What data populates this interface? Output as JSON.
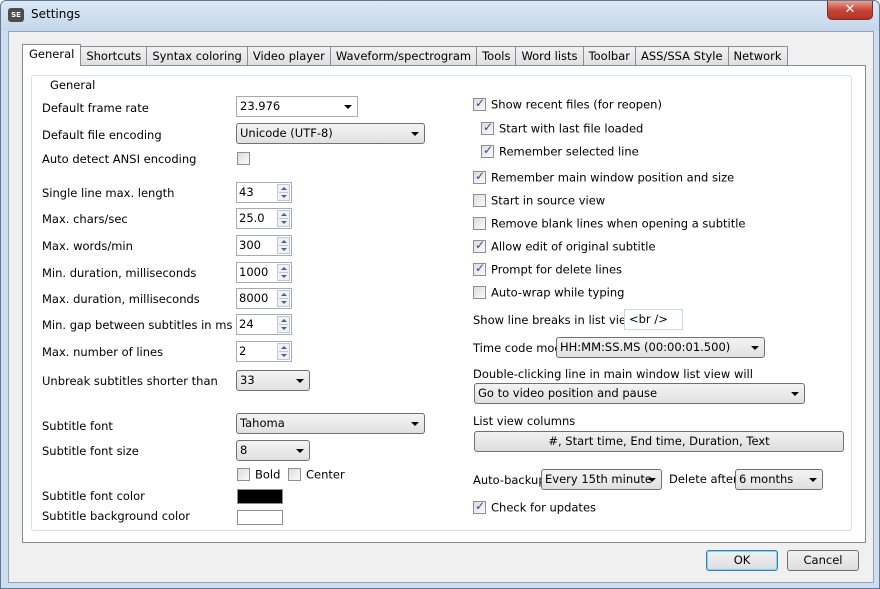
{
  "window": {
    "title": "Settings",
    "app_icon_text": "SE",
    "close_glyph": "✕"
  },
  "tabs": [
    {
      "label": "General",
      "active": true
    },
    {
      "label": "Shortcuts"
    },
    {
      "label": "Syntax coloring"
    },
    {
      "label": "Video player"
    },
    {
      "label": "Waveform/spectrogram"
    },
    {
      "label": "Tools"
    },
    {
      "label": "Word lists"
    },
    {
      "label": "Toolbar"
    },
    {
      "label": "ASS/SSA Style"
    },
    {
      "label": "Network"
    }
  ],
  "group": {
    "title": "General"
  },
  "left": {
    "default_frame_rate": {
      "label": "Default frame rate",
      "value": "23.976"
    },
    "default_file_encoding": {
      "label": "Default file encoding",
      "value": "Unicode (UTF-8)"
    },
    "auto_detect_ansi": {
      "label": "Auto detect ANSI encoding",
      "checked": false
    },
    "single_line_max_length": {
      "label": "Single line max. length",
      "value": "43"
    },
    "max_chars_sec": {
      "label": "Max. chars/sec",
      "value": "25.0"
    },
    "max_words_min": {
      "label": "Max. words/min",
      "value": "300"
    },
    "min_duration": {
      "label": "Min. duration, milliseconds",
      "value": "1000"
    },
    "max_duration": {
      "label": "Max. duration, milliseconds",
      "value": "8000"
    },
    "min_gap": {
      "label": "Min. gap between subtitles in ms",
      "value": "24"
    },
    "max_lines": {
      "label": "Max. number of lines",
      "value": "2"
    },
    "unbreak_shorter": {
      "label": "Unbreak subtitles shorter than",
      "value": "33"
    },
    "subtitle_font": {
      "label": "Subtitle font",
      "value": "Tahoma"
    },
    "subtitle_font_size": {
      "label": "Subtitle font size",
      "value": "8"
    },
    "bold": {
      "label": "Bold",
      "checked": false
    },
    "center": {
      "label": "Center",
      "checked": false
    },
    "font_color": {
      "label": "Subtitle font color",
      "color": "#000000"
    },
    "background_color": {
      "label": "Subtitle background color",
      "color": "#ffffff"
    }
  },
  "right": {
    "checks": [
      {
        "label": "Show recent files (for reopen)",
        "checked": true
      },
      {
        "label": "Start with last file loaded",
        "checked": true
      },
      {
        "label": "Remember selected line",
        "checked": true
      },
      {
        "label": "Remember main window position and size",
        "checked": true
      },
      {
        "label": "Start in source view",
        "checked": false
      },
      {
        "label": "Remove blank lines when opening a subtitle",
        "checked": false
      },
      {
        "label": "Allow edit of original subtitle",
        "checked": true
      },
      {
        "label": "Prompt for delete lines",
        "checked": true
      },
      {
        "label": "Auto-wrap while typing",
        "checked": false
      }
    ],
    "line_breaks": {
      "label": "Show line breaks in list view as",
      "value": "<br />"
    },
    "time_code_mode": {
      "label": "Time code mode",
      "value": "HH:MM:SS.MS (00:00:01.500)"
    },
    "double_click": {
      "label": "Double-clicking line in main window list view will",
      "value": "Go to video position and pause"
    },
    "list_view_columns": {
      "label": "List view columns",
      "value": "#, Start time, End time, Duration, Text"
    },
    "auto_backup": {
      "label": "Auto-backup",
      "value": "Every 15th minute"
    },
    "delete_after": {
      "label": "Delete after",
      "value": "6 months"
    },
    "check_updates": {
      "label": "Check for updates",
      "checked": true
    }
  },
  "buttons": {
    "ok": "OK",
    "cancel": "Cancel"
  }
}
